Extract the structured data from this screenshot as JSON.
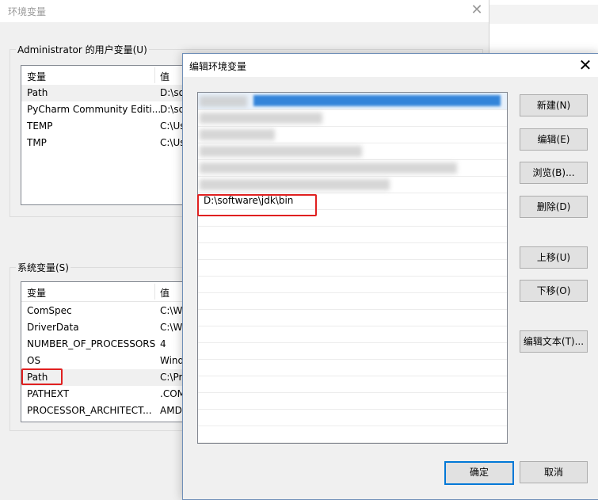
{
  "background_window": {
    "title": "环境变量",
    "close_glyph": "✕",
    "user_vars": {
      "group_label": "Administrator 的用户变量(U)",
      "columns": [
        "变量",
        "值"
      ],
      "rows": [
        {
          "name": "Path",
          "value": "D:\\so"
        },
        {
          "name": "PyCharm Community Editi...",
          "value": "D:\\so"
        },
        {
          "name": "TEMP",
          "value": "C:\\Us"
        },
        {
          "name": "TMP",
          "value": "C:\\Us"
        }
      ]
    },
    "system_vars": {
      "group_label": "系统变量(S)",
      "columns": [
        "变量",
        "值"
      ],
      "rows": [
        {
          "name": "ComSpec",
          "value": "C:\\W"
        },
        {
          "name": "DriverData",
          "value": "C:\\W"
        },
        {
          "name": "NUMBER_OF_PROCESSORS",
          "value": "4"
        },
        {
          "name": "OS",
          "value": "Wind"
        },
        {
          "name": "Path",
          "value": "C:\\Pr"
        },
        {
          "name": "PATHEXT",
          "value": ".COM"
        },
        {
          "name": "PROCESSOR_ARCHITECT...",
          "value": "AMD"
        }
      ],
      "selected_row": "Path"
    }
  },
  "dialog": {
    "title": "编辑环境变量",
    "close_glyph": "✕",
    "path_entries": [
      {
        "text": "",
        "blurred": true,
        "selected": true
      },
      {
        "text": "",
        "blurred": true
      },
      {
        "text": "",
        "blurred": true
      },
      {
        "text": "",
        "blurred": true
      },
      {
        "text": "",
        "blurred": true
      },
      {
        "text": "",
        "blurred": true
      },
      {
        "text": "D:\\software\\jdk\\bin",
        "blurred": false,
        "highlighted": true
      }
    ],
    "buttons": {
      "new": "新建(N)",
      "edit": "编辑(E)",
      "browse": "浏览(B)...",
      "delete": "删除(D)",
      "move_up": "上移(U)",
      "move_down": "下移(O)",
      "edit_text": "编辑文本(T)...",
      "ok": "确定",
      "cancel": "取消"
    }
  },
  "colors": {
    "highlight_box": "#e02020",
    "selection_blue": "#2a7fd8",
    "default_button_border": "#0078d7"
  }
}
